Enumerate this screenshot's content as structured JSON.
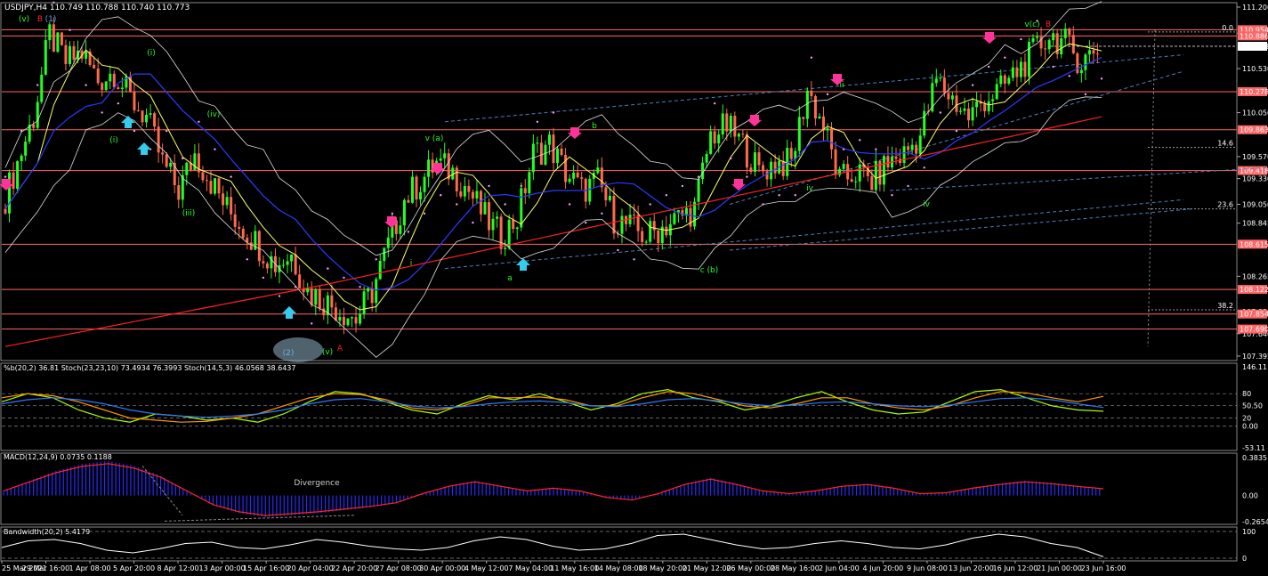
{
  "header": {
    "title": "USDJPY,H4  110.749 110.788 110.740 110.773"
  },
  "chart_data": [
    {
      "type": "line",
      "panel": "price",
      "title": "USDJPY,H4  110.749 110.788 110.740 110.773",
      "y_ticks": [
        "111.200",
        "110.915",
        "110.530",
        "110.050",
        "109.570",
        "109.330",
        "109.050",
        "108.845",
        "108.265",
        "107.880",
        "107.640",
        "107.395"
      ],
      "ylim": [
        107.395,
        111.2
      ],
      "last_price": "110.773",
      "h_levels": [
        {
          "value": "110.954",
          "color": "#ff6666"
        },
        {
          "value": "110.886",
          "color": "#ff6666"
        },
        {
          "value": "110.278",
          "color": "#ff6666"
        },
        {
          "value": "109.863",
          "color": "#ff6666"
        },
        {
          "value": "109.418",
          "color": "#ff6666"
        },
        {
          "value": "108.615",
          "color": "#ff6666"
        },
        {
          "value": "108.122",
          "color": "#ff6666"
        },
        {
          "value": "107.854",
          "color": "#ff6666"
        },
        {
          "value": "107.690",
          "color": "#ff6666"
        }
      ],
      "fib_labels": [
        "0.0",
        "14.6",
        "23.6",
        "38.2"
      ],
      "wave_labels": [
        {
          "text": "(v)",
          "color": "#22ff22"
        },
        {
          "text": "B",
          "color": "#ff2222"
        },
        {
          "text": "(1)",
          "color": "#4da6ff"
        },
        {
          "text": "(i)",
          "color": "#22ff22"
        },
        {
          "text": "(i)",
          "color": "#22ff22"
        },
        {
          "text": "(iii)",
          "color": "#22ff22"
        },
        {
          "text": "(iv)",
          "color": "#22ff22"
        },
        {
          "text": "(2)",
          "color": "#4da6ff"
        },
        {
          "text": "(v)",
          "color": "#22ff22"
        },
        {
          "text": "A",
          "color": "#ff2222"
        },
        {
          "text": "i",
          "color": "#22ff22"
        },
        {
          "text": "v (a)",
          "color": "#22ff22"
        },
        {
          "text": "a",
          "color": "#22ff22"
        },
        {
          "text": "b",
          "color": "#22ff22"
        },
        {
          "text": "c (b)",
          "color": "#22ff22"
        },
        {
          "text": "ii",
          "color": "#22ff22"
        },
        {
          "text": "iv",
          "color": "#22ff22"
        },
        {
          "text": "iv",
          "color": "#22ff22"
        },
        {
          "text": "v(c)",
          "color": "#22ff22"
        },
        {
          "text": "B",
          "color": "#ff2222"
        }
      ],
      "close_series": [
        109.0,
        109.5,
        110.0,
        110.9,
        110.6,
        110.7,
        110.4,
        110.5,
        110.2,
        110.0,
        109.5,
        109.2,
        109.6,
        109.3,
        109.0,
        108.8,
        108.6,
        108.4,
        108.5,
        108.1,
        108.0,
        107.9,
        107.8,
        108.1,
        108.6,
        109.1,
        109.3,
        109.5,
        109.4,
        109.2,
        108.9,
        108.7,
        108.9,
        109.6,
        109.7,
        109.4,
        109.2,
        109.3,
        108.9,
        108.8,
        108.7,
        108.8,
        108.9,
        109.0,
        109.8,
        109.9,
        109.7,
        109.4,
        109.5,
        109.5,
        110.3,
        109.9,
        109.3,
        109.4,
        109.3,
        109.5,
        109.6,
        109.8,
        110.4,
        110.2,
        110.0,
        110.2,
        110.3,
        110.5,
        110.7,
        110.9,
        110.8,
        110.6,
        110.77
      ],
      "ma_colors": {
        "ma_short": "#ffff66",
        "ma_mid": "#2a3aff",
        "ma_long": "#ff2222",
        "bollinger": "#dddddd",
        "sar": "#ff99ff"
      }
    },
    {
      "type": "line",
      "panel": "oscillator",
      "title": "%b(20,2) 36.81  Stoch(23,23,10) 73.4934 76.3993  Stoch(14,5,3) 46.0568 38.6437",
      "y_ticks": [
        "146.11",
        "80",
        "50.50",
        "0.00",
        "20",
        "-53.11"
      ],
      "series": [
        {
          "name": "%b(20,2)",
          "color": "#aaff00",
          "values": [
            60,
            80,
            70,
            40,
            20,
            10,
            30,
            25,
            15,
            20,
            10,
            30,
            60,
            85,
            80,
            60,
            40,
            30,
            55,
            75,
            65,
            80,
            60,
            40,
            55,
            80,
            90,
            70,
            60,
            40,
            50,
            70,
            85,
            60,
            40,
            30,
            35,
            60,
            85,
            90,
            70,
            50,
            40,
            36.81
          ]
        },
        {
          "name": "Stoch(23,23,10)",
          "color": "#ff9900",
          "values": [
            70,
            80,
            75,
            60,
            40,
            20,
            15,
            10,
            12,
            20,
            30,
            50,
            70,
            80,
            78,
            65,
            45,
            40,
            50,
            70,
            70,
            72,
            65,
            50,
            50,
            70,
            85,
            80,
            65,
            50,
            45,
            55,
            70,
            70,
            55,
            45,
            40,
            50,
            70,
            85,
            82,
            70,
            60,
            73.49
          ]
        },
        {
          "name": "Stoch(14,5,3)",
          "color": "#2a7aff",
          "values": [
            55,
            65,
            70,
            65,
            55,
            40,
            30,
            25,
            22,
            25,
            30,
            40,
            55,
            65,
            68,
            60,
            50,
            45,
            48,
            55,
            60,
            62,
            58,
            50,
            48,
            55,
            65,
            68,
            62,
            55,
            50,
            52,
            58,
            60,
            55,
            50,
            48,
            52,
            60,
            68,
            70,
            65,
            55,
            46.06
          ]
        }
      ]
    },
    {
      "type": "bar",
      "panel": "macd",
      "title": "MACD(12,24,9) 0.0735 0.1188",
      "y_ticks": [
        "0.3835",
        "0.00",
        "-0.2654"
      ],
      "annotation": "Divergence",
      "hist_color": "#2a2aff",
      "signal_color": "#ff2222",
      "values": [
        0.05,
        0.15,
        0.25,
        0.32,
        0.35,
        0.3,
        0.2,
        0.05,
        -0.1,
        -0.18,
        -0.22,
        -0.2,
        -0.18,
        -0.15,
        -0.12,
        -0.08,
        0.02,
        0.1,
        0.15,
        0.1,
        0.05,
        0.08,
        0.05,
        -0.02,
        -0.05,
        0.02,
        0.12,
        0.18,
        0.12,
        0.05,
        0.02,
        0.05,
        0.1,
        0.12,
        0.08,
        0.02,
        0.03,
        0.08,
        0.12,
        0.15,
        0.13,
        0.1,
        0.0735
      ]
    },
    {
      "type": "line",
      "panel": "bandwidth",
      "title": "Bandwidth(20,2) 5.4179",
      "y_ticks": [
        "100",
        "0"
      ],
      "color": "#ffffff",
      "values": [
        40,
        65,
        70,
        55,
        30,
        20,
        35,
        55,
        60,
        40,
        35,
        50,
        70,
        60,
        45,
        35,
        30,
        40,
        65,
        80,
        70,
        45,
        30,
        35,
        55,
        85,
        90,
        70,
        50,
        35,
        40,
        55,
        65,
        55,
        40,
        35,
        50,
        75,
        90,
        80,
        55,
        40,
        5.42
      ]
    },
    {
      "type": "table",
      "panel": "time-axis",
      "x_ticks": [
        "25 Mar 2021",
        "29 Mar 16:00",
        "1 Apr 08:00",
        "5 Apr 20:00",
        "8 Apr 12:00",
        "13 Apr 00:00",
        "15 Apr 16:00",
        "20 Apr 04:00",
        "22 Apr 20:00",
        "27 Apr 08:00",
        "30 Apr 00:00",
        "4 May 12:00",
        "7 May 04:00",
        "11 May 16:00",
        "14 May 08:00",
        "18 May 20:00",
        "21 May 12:00",
        "26 May 00:00",
        "28 May 16:00",
        "2 Jun 04:00",
        "4 Jun 20:00",
        "9 Jun 08:00",
        "13 Jun 20:00",
        "16 Jun 12:00",
        "21 Jun 00:00",
        "23 Jun 16:00"
      ]
    }
  ]
}
